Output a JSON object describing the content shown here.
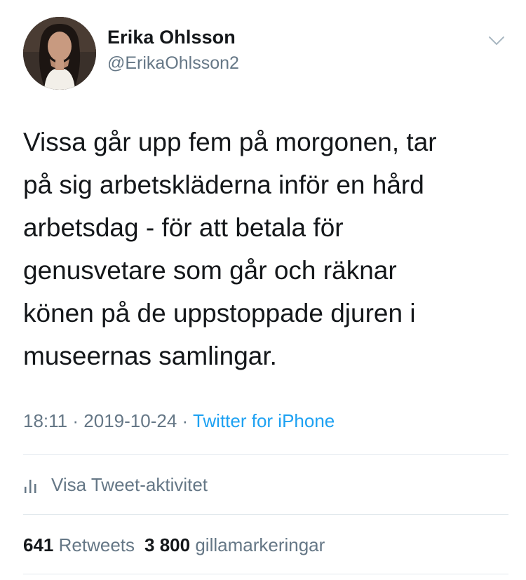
{
  "user": {
    "name": "Erika Ohlsson",
    "handle": "@ErikaOhlsson2"
  },
  "tweet": {
    "text": "Vissa går upp fem på morgonen, tar\npå sig arbetskläderna inför en hård\narbetsdag - för att betala för\ngenusvetare som går och räknar\nkönen på de uppstoppade djuren i\nmuseernas samlingar.",
    "time": "18:11",
    "date": "2019-10-24",
    "separator": "·",
    "source": "Twitter for iPhone"
  },
  "activity": {
    "label": "Visa Tweet-aktivitet",
    "icon": "bar-chart-icon"
  },
  "stats": {
    "retweets_count": "641",
    "retweets_label": "Retweets",
    "likes_count": "3 800",
    "likes_label": "gillamarkeringar"
  },
  "icons": {
    "menu": "chevron-down-icon"
  },
  "colors": {
    "text": "#14171a",
    "secondary": "#657786",
    "link": "#1da1f2",
    "divider": "#e1e8ed"
  }
}
